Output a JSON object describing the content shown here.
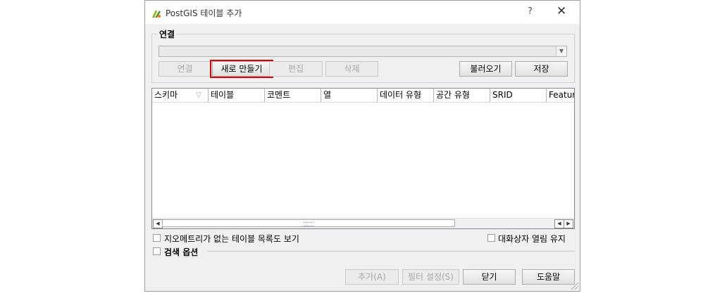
{
  "window": {
    "title": "PostGIS 테이블 추가",
    "help_glyph": "?",
    "close_glyph": "✕",
    "icon": "qgis-logo-icon"
  },
  "connections": {
    "group_title": "연결",
    "combo_value": "",
    "buttons": {
      "connect": "연결",
      "new": "새로 만들기",
      "edit": "편집",
      "remove": "삭제",
      "load": "불러오기",
      "save": "저장"
    }
  },
  "table": {
    "columns": [
      "스키마",
      "테이블",
      "코멘트",
      "열",
      "데이터 유형",
      "공간 유형",
      "SRID",
      "Feature"
    ],
    "rows": []
  },
  "options": {
    "show_no_geometry_label": "지오메트리가 없는 테이블 목록도 보기",
    "keep_dialog_open_label": "대화상자 열림 유지",
    "search_options_label": "검색 옵션"
  },
  "footer": {
    "add": "추가(A)",
    "set_filter": "필터 설정(S)",
    "close": "닫기",
    "help": "도움말"
  },
  "colors": {
    "highlight": "#e00000",
    "dialog_bg": "#f0f0f0"
  }
}
